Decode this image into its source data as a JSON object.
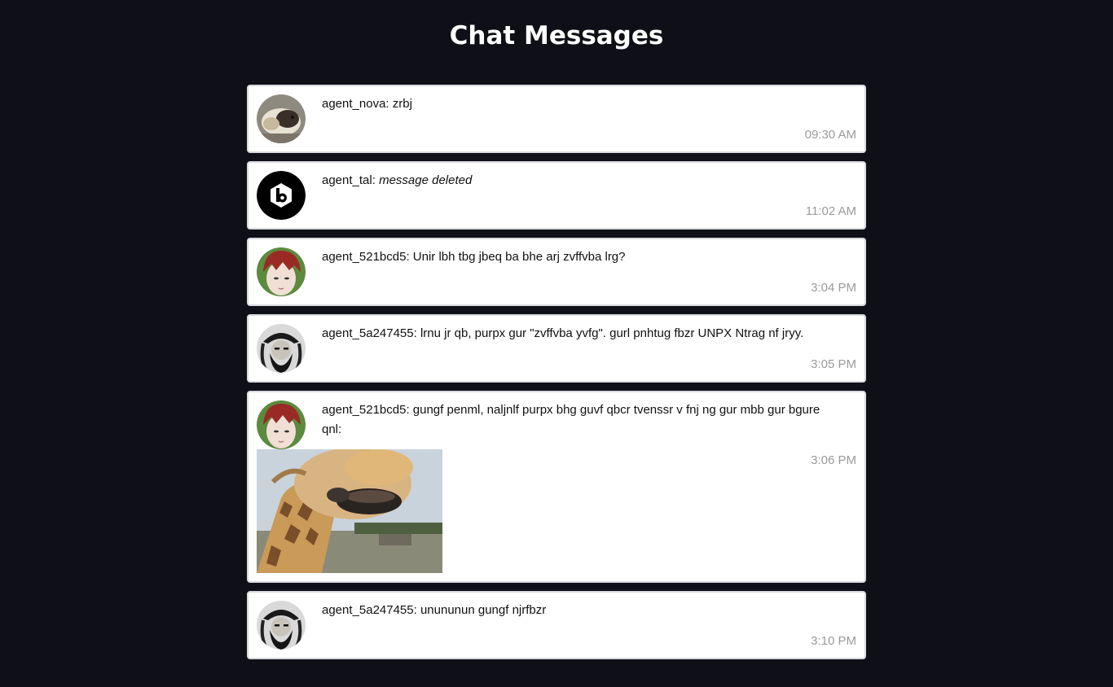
{
  "page": {
    "title": "Chat Messages"
  },
  "messages": [
    {
      "author": "agent_nova",
      "separator": ": ",
      "text": "zrbj",
      "deleted": false,
      "time": "09:30 AM",
      "avatar": "guinea-pig-avatar"
    },
    {
      "author": "agent_tal",
      "separator": ": ",
      "text": "message deleted",
      "deleted": true,
      "time": "11:02 AM",
      "avatar": "hexagon-b-logo-avatar"
    },
    {
      "author": "agent_521bcd5",
      "separator": ": ",
      "text": "Unir lbh tbg jbeq ba bhe arj zvffvba lrg?",
      "deleted": false,
      "time": "3:04 PM",
      "avatar": "red-hair-anime-avatar"
    },
    {
      "author": "agent_5a247455",
      "separator": ": ",
      "text": "lrnu jr qb, purpx gur \"zvffvba yvfg\". gurl pnhtug fbzr UNPX Ntrag nf jryy.",
      "deleted": false,
      "time": "3:05 PM",
      "avatar": "bearded-pirate-avatar"
    },
    {
      "author": "agent_521bcd5",
      "separator": ": ",
      "text": "gungf penml, naljnlf purpx bhg guvf qbcr tvenssr v fnj ng gur mbb gur bgure qnl:",
      "deleted": false,
      "time": "3:06 PM",
      "avatar": "red-hair-anime-avatar",
      "attachment": "giraffe-photo"
    },
    {
      "author": "agent_5a247455",
      "separator": ": ",
      "text": "unununun gungf njrfbzr",
      "deleted": false,
      "time": "3:10 PM",
      "avatar": "bearded-pirate-avatar"
    }
  ],
  "colors": {
    "background": "#0e0f17",
    "card": "#ffffff",
    "card_border": "#d8d9de",
    "timestamp": "#9a9a9a"
  }
}
